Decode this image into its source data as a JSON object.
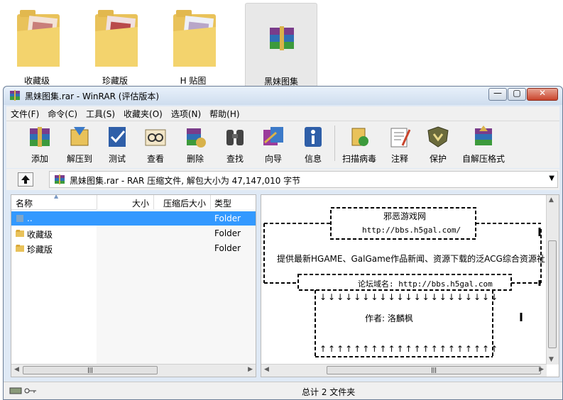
{
  "desktop": {
    "items": [
      {
        "label": "收藏级"
      },
      {
        "label": "珍藏版"
      },
      {
        "label": "H 贴图"
      },
      {
        "label": "黑妹图集"
      }
    ]
  },
  "window": {
    "title": "黑妹图集.rar - WinRAR (评估版本)",
    "buttons": {
      "minimize": "—",
      "maximize": "▢",
      "close": "✕"
    }
  },
  "menu": [
    "文件(F)",
    "命令(C)",
    "工具(S)",
    "收藏夹(O)",
    "选项(N)",
    "帮助(H)"
  ],
  "toolbar": [
    {
      "label": "添加",
      "icon": "add-archive-icon"
    },
    {
      "label": "解压到",
      "icon": "extract-to-icon"
    },
    {
      "label": "测试",
      "icon": "test-icon"
    },
    {
      "label": "查看",
      "icon": "view-icon"
    },
    {
      "label": "删除",
      "icon": "delete-icon"
    },
    {
      "label": "查找",
      "icon": "find-icon"
    },
    {
      "label": "向导",
      "icon": "wizard-icon"
    },
    {
      "label": "信息",
      "icon": "info-icon"
    },
    {
      "label": "扫描病毒",
      "icon": "virus-scan-icon"
    },
    {
      "label": "注释",
      "icon": "comment-icon"
    },
    {
      "label": "保护",
      "icon": "protect-icon"
    },
    {
      "label": "自解压格式",
      "icon": "sfx-icon"
    }
  ],
  "address": {
    "text": "黑妹图集.rar - RAR 压缩文件, 解包大小为 47,147,010 字节"
  },
  "filelist": {
    "columns": {
      "name": "名称",
      "size": "大小",
      "packed": "压缩后大小",
      "type": "类型"
    },
    "rows": [
      {
        "name": "..",
        "type": "Folder",
        "selected": true
      },
      {
        "name": "收藏级",
        "type": "Folder",
        "selected": false
      },
      {
        "name": "珍藏版",
        "type": "Folder",
        "selected": false
      }
    ]
  },
  "comment": {
    "site_name": "邪恶游戏网",
    "url": "http://bbs.h5gal.com/",
    "slogan": "提供最新HGAME、GalGame作品新闻、资源下载的泛ACG综合资源社区.",
    "domain_line": "论坛域名: http://bbs.h5gal.com",
    "author": "作者:  洛麟枫",
    "down_arrows": "↓↓↓↓↓↓↓↓↓↓↓↓↓↓↓↓↓↓↓↓↓",
    "up_arrows": "↑↑↑↑↑↑↑↑↑↑↑↑↑↑↑↑↑↑↑↑↑"
  },
  "status": {
    "text": "总计 2 文件夹"
  },
  "colors": {
    "selection": "#3399ff",
    "title_bg": "#dfe9f5",
    "close_button": "#c9442c"
  }
}
